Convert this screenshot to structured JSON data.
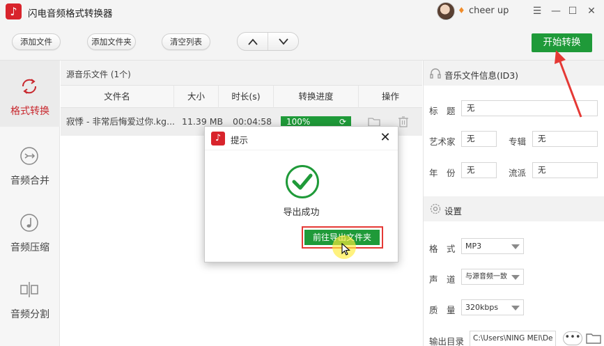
{
  "app": {
    "title": "闪电音频格式转换器",
    "logo_glyph": "♪",
    "username": "cheer up",
    "vip_icon": "vip-diamond-icon"
  },
  "window_controls": {
    "menu": "☰",
    "minimize": "—",
    "maximize": "☐",
    "close": "✕"
  },
  "toolbar": {
    "add_file": "添加文件",
    "add_folder": "添加文件夹",
    "clear_list": "清空列表",
    "move_up": "︿",
    "move_down": "﹀",
    "start": "开始转换"
  },
  "sidebar": {
    "items": [
      {
        "label": "格式转换",
        "icon": "refresh-cycle-icon",
        "active": true
      },
      {
        "label": "音频合并",
        "icon": "merge-arrows-icon",
        "active": false
      },
      {
        "label": "音频压缩",
        "icon": "music-note-icon",
        "active": false
      },
      {
        "label": "音频分割",
        "icon": "split-icon",
        "active": false
      }
    ]
  },
  "filelist": {
    "source_title": "源音乐文件 (1个)",
    "columns": [
      "文件名",
      "大小",
      "时长(s)",
      "转换进度",
      "操作"
    ],
    "rows": [
      {
        "filename": "寂悸 - 非常后悔爱过你.kg...",
        "size": "11.39 MB",
        "duration": "00:04:58",
        "progress": "100%",
        "progress_value": 1.0
      }
    ]
  },
  "id3": {
    "title": "音乐文件信息(ID3)",
    "fields": {
      "title_label": "标　题",
      "title_value": "无",
      "artist_label": "艺术家",
      "artist_value": "无",
      "album_label": "专辑",
      "album_value": "无",
      "year_label": "年　份",
      "year_value": "无",
      "genre_label": "流派",
      "genre_value": "无"
    }
  },
  "settings": {
    "title": "设置",
    "format_label": "格　式",
    "format_value": "MP3",
    "channel_label": "声　道",
    "channel_value": "与源音频一致",
    "quality_label": "质　量",
    "quality_value": "320kbps",
    "output_label": "输出目录",
    "output_value": "C:\\Users\\NING MEI\\De",
    "dots": "•••"
  },
  "modal": {
    "title": "提示",
    "message": "导出成功",
    "button": "前往导出文件夹",
    "close": "✕"
  },
  "colors": {
    "brand_red": "#d8242c",
    "green": "#1f9a39",
    "annotation_red": "#e53935"
  }
}
